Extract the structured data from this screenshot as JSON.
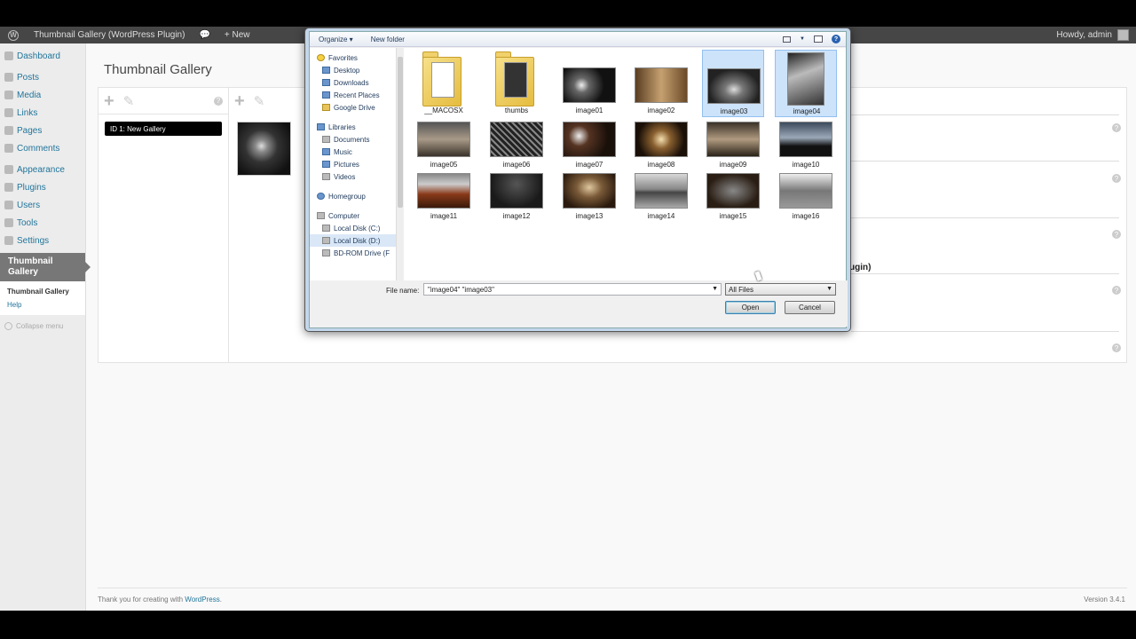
{
  "admin_bar": {
    "site_name": "Thumbnail Gallery (WordPress Plugin)",
    "new_label": "New",
    "howdy": "Howdy, admin"
  },
  "sidebar": {
    "items": [
      {
        "label": "Dashboard",
        "icon": "dashboard-icon"
      },
      {
        "label": "Posts",
        "icon": "posts-icon"
      },
      {
        "label": "Media",
        "icon": "media-icon"
      },
      {
        "label": "Links",
        "icon": "links-icon"
      },
      {
        "label": "Pages",
        "icon": "pages-icon"
      },
      {
        "label": "Comments",
        "icon": "comments-icon"
      },
      {
        "label": "Appearance",
        "icon": "appearance-icon"
      },
      {
        "label": "Plugins",
        "icon": "plugins-icon"
      },
      {
        "label": "Users",
        "icon": "users-icon"
      },
      {
        "label": "Tools",
        "icon": "tools-icon"
      },
      {
        "label": "Settings",
        "icon": "settings-icon"
      }
    ],
    "current": "Thumbnail Gallery",
    "submenu": [
      "Thumbnail Gallery",
      "Help"
    ],
    "collapse": "Collapse menu"
  },
  "page": {
    "title": "Thumbnail Gallery",
    "gallery_item": "ID 1: New Gallery",
    "partial_text": "ugin)"
  },
  "footer": {
    "thanks": "Thank you for creating with",
    "wp_link": "WordPress",
    "version": "Version 3.4.1"
  },
  "dialog": {
    "organize": "Organize ▾",
    "new_folder": "New folder",
    "nav": {
      "favorites": "Favorites",
      "fav_items": [
        "Desktop",
        "Downloads",
        "Recent Places",
        "Google Drive"
      ],
      "libraries": "Libraries",
      "lib_items": [
        "Documents",
        "Music",
        "Pictures",
        "Videos"
      ],
      "homegroup": "Homegroup",
      "computer": "Computer",
      "comp_items": [
        "Local Disk (C:)",
        "Local Disk (D:)",
        "BD-ROM Drive (F"
      ]
    },
    "files": [
      "__MACOSX",
      "thumbs",
      "image01",
      "image02",
      "image03",
      "image04",
      "image05",
      "image06",
      "image07",
      "image08",
      "image09",
      "image10",
      "image11",
      "image12",
      "image13",
      "image14",
      "image15",
      "image16"
    ],
    "selected_files": [
      "image03",
      "image04"
    ],
    "file_name_label": "File name:",
    "file_name_value": "\"image04\" \"image03\"",
    "file_type": "All Files",
    "open": "Open",
    "cancel": "Cancel"
  }
}
